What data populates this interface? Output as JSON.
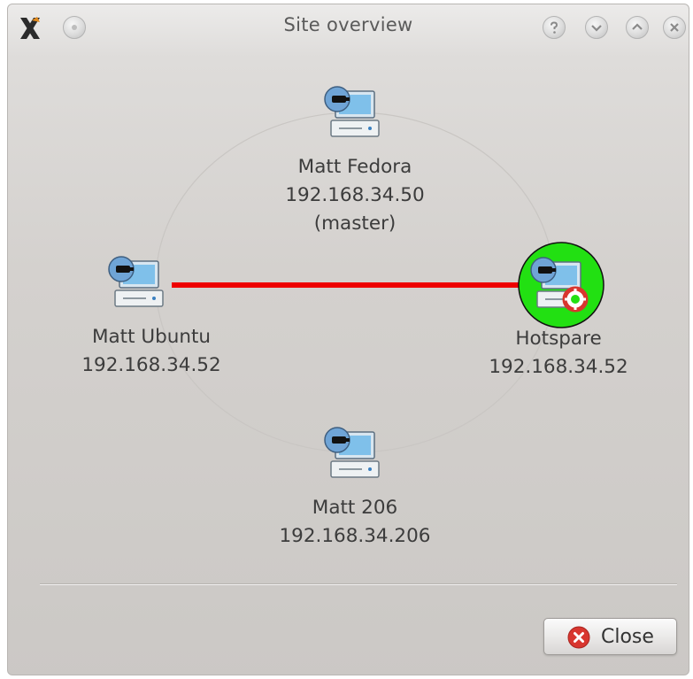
{
  "window": {
    "title": "Site overview"
  },
  "nodes": [
    {
      "name": "Matt Fedora",
      "ip": "192.168.34.50",
      "role": "(master)",
      "icon": "server-icon"
    },
    {
      "name": "Matt Ubuntu",
      "ip": "192.168.34.52",
      "role": "",
      "icon": "server-icon"
    },
    {
      "name": "Hotspare",
      "ip": "192.168.34.52",
      "role": "",
      "icon": "hotspare-server-icon",
      "highlight": "#22e012"
    },
    {
      "name": "Matt 206",
      "ip": "192.168.34.206",
      "role": "",
      "icon": "server-icon"
    }
  ],
  "link": {
    "from": "Matt Ubuntu",
    "to": "Hotspare",
    "color": "#ee0000"
  },
  "footer": {
    "close_label": "Close",
    "close_icon": "close-circle-icon"
  },
  "colors": {
    "ring": "#c9c6c3",
    "monitor": "#7fc0ea",
    "close_icon": "#d8362f"
  }
}
